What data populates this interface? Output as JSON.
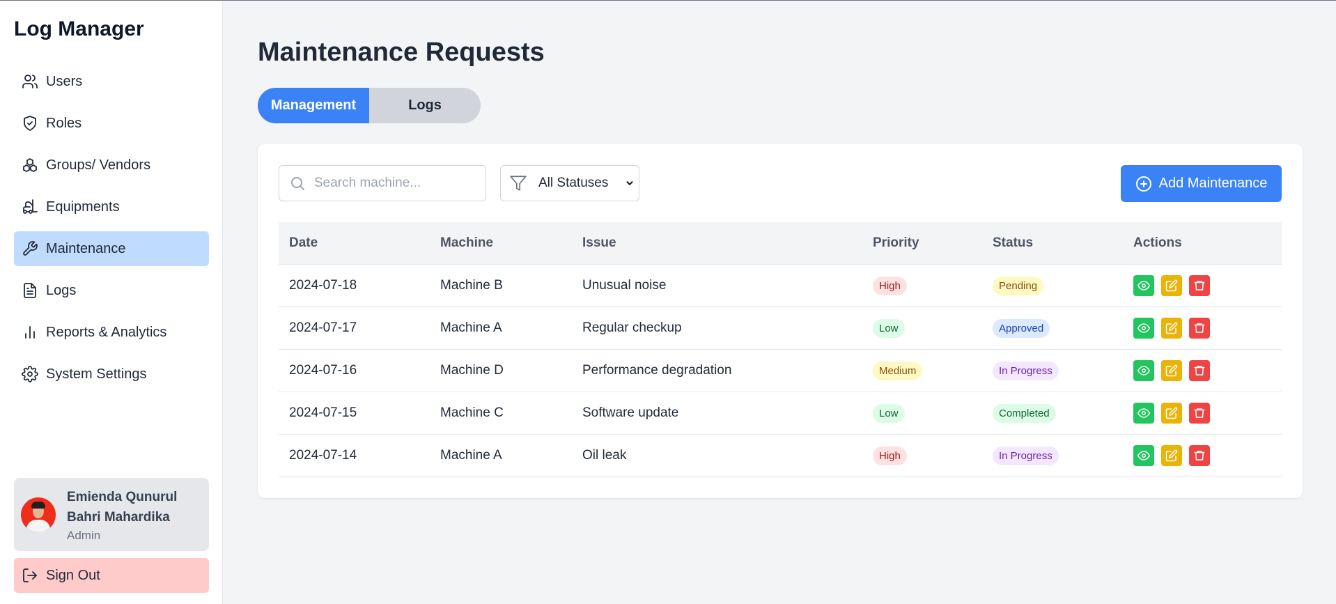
{
  "app": {
    "title": "Log Manager"
  },
  "sidebar": {
    "items": [
      {
        "label": "Users",
        "icon": "users-icon"
      },
      {
        "label": "Roles",
        "icon": "shield-icon"
      },
      {
        "label": "Groups/ Vendors",
        "icon": "boxes-icon"
      },
      {
        "label": "Equipments",
        "icon": "forklift-icon"
      },
      {
        "label": "Maintenance",
        "icon": "wrench-icon",
        "active": true
      },
      {
        "label": "Logs",
        "icon": "file-text-icon"
      },
      {
        "label": "Reports & Analytics",
        "icon": "bar-chart-icon"
      },
      {
        "label": "System Settings",
        "icon": "gear-icon"
      }
    ],
    "user": {
      "name": "Emienda Qunurul Bahri Mahardika",
      "role": "Admin"
    },
    "signout_label": "Sign Out"
  },
  "page": {
    "title": "Maintenance Requests",
    "tabs": [
      {
        "label": "Management",
        "active": true
      },
      {
        "label": "Logs",
        "active": false
      }
    ]
  },
  "toolbar": {
    "search_placeholder": "Search machine...",
    "filter_selected": "All Statuses",
    "add_label": "Add Maintenance"
  },
  "table": {
    "headers": [
      "Date",
      "Machine",
      "Issue",
      "Priority",
      "Status",
      "Actions"
    ],
    "rows": [
      {
        "date": "2024-07-18",
        "machine": "Machine B",
        "issue": "Unusual noise",
        "priority": "High",
        "status": "Pending"
      },
      {
        "date": "2024-07-17",
        "machine": "Machine A",
        "issue": "Regular checkup",
        "priority": "Low",
        "status": "Approved"
      },
      {
        "date": "2024-07-16",
        "machine": "Machine D",
        "issue": "Performance degradation",
        "priority": "Medium",
        "status": "In Progress"
      },
      {
        "date": "2024-07-15",
        "machine": "Machine C",
        "issue": "Software update",
        "priority": "Low",
        "status": "Completed"
      },
      {
        "date": "2024-07-14",
        "machine": "Machine A",
        "issue": "Oil leak",
        "priority": "High",
        "status": "In Progress"
      }
    ]
  },
  "colors": {
    "accent": "#3b82f6",
    "active_nav_bg": "#bfdbfe",
    "signout_bg": "#fecaca",
    "view_action": "#22c55e",
    "edit_action": "#eab308",
    "delete_action": "#ef4444"
  }
}
